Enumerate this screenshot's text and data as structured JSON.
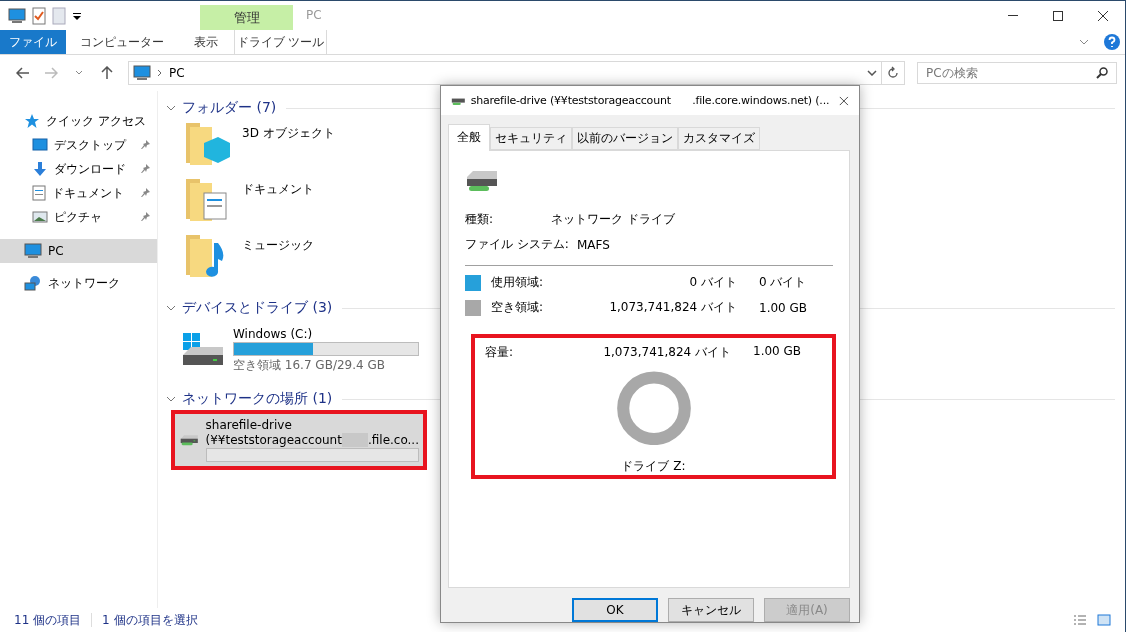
{
  "title_bar": {
    "context_tab": "管理",
    "title": "PC"
  },
  "ribbon_tabs": [
    {
      "label": "ファイル",
      "kind": "file"
    },
    {
      "label": "コンピューター",
      "kind": "tab"
    },
    {
      "label": "表示",
      "kind": "tab"
    },
    {
      "label": "ドライブ ツール",
      "kind": "context"
    }
  ],
  "address_bar": {
    "path": "PC"
  },
  "search": {
    "placeholder": "PCの検索"
  },
  "sidebar": {
    "items": [
      {
        "label": "クイック アクセス",
        "kind": "star",
        "selected": false,
        "children": [
          {
            "label": "デスクトップ",
            "kind": "desktop",
            "selected": false,
            "pinned": true
          },
          {
            "label": "ダウンロード",
            "kind": "download",
            "selected": false,
            "pinned": true
          },
          {
            "label": "ドキュメント",
            "kind": "document",
            "selected": false,
            "pinned": true
          },
          {
            "label": "ピクチャ",
            "kind": "picture",
            "selected": false,
            "pinned": true
          }
        ]
      },
      {
        "label": "PC",
        "kind": "pc",
        "selected": true
      },
      {
        "label": "ネットワーク",
        "kind": "network",
        "selected": false
      }
    ]
  },
  "groups": [
    {
      "title": "フォルダー (7)",
      "items": [
        {
          "kind": "folder_3d",
          "name": "3D オブジェクト"
        },
        {
          "kind": "folder_documents",
          "name": "ドキュメント"
        },
        {
          "kind": "folder_music",
          "name": "ミュージック"
        }
      ]
    },
    {
      "title": "デバイスとドライブ (3)",
      "items": [
        {
          "kind": "local_drive",
          "name": "Windows (C:)",
          "level": 0.43,
          "detail": "空き領域 16.7 GB/29.4 GB",
          "selected": false,
          "highlighted": false
        }
      ]
    },
    {
      "title": "ネットワークの場所 (1)",
      "items": [
        {
          "kind": "network_drive",
          "name": "sharefile-drive",
          "path_start": "(¥¥teststorageaccount",
          "path_end": ".file.co...",
          "selected": true,
          "highlighted": true
        }
      ]
    }
  ],
  "status_bar": {
    "item_count": "11 個の項目",
    "selection": "1 個の項目を選択"
  },
  "dialog": {
    "title_start": "sharefile-drive (¥¥teststorageaccount",
    "title_end": ".file.core.windows.net) (...",
    "tabs": [
      {
        "label": "全般",
        "selected": true
      },
      {
        "label": "セキュリティ",
        "selected": false
      },
      {
        "label": "以前のバージョン",
        "selected": false
      },
      {
        "label": "カスタマイズ",
        "selected": false
      }
    ],
    "properties": [
      {
        "label": "種類:",
        "value": "ネットワーク ドライブ"
      },
      {
        "label": "ファイル システム:",
        "value": "MAFS"
      }
    ],
    "usage": [
      {
        "label": "使用領域:",
        "bytes": "0 バイト",
        "size": "0 バイト",
        "color": "#26a0da"
      },
      {
        "label": "空き領域:",
        "bytes": "1,073,741,824 バイト",
        "size": "1.00 GB",
        "color": "#a8a8a8"
      }
    ],
    "capacity": {
      "label": "容量:",
      "bytes": "1,073,741,824 バイト",
      "size": "1.00 GB",
      "drive_label": "ドライブ Z:",
      "highlighted": true
    },
    "buttons": [
      {
        "label": "OK",
        "kind": "default"
      },
      {
        "label": "キャンセル",
        "kind": "normal"
      },
      {
        "label": "適用(A)",
        "kind": "disabled"
      }
    ]
  }
}
